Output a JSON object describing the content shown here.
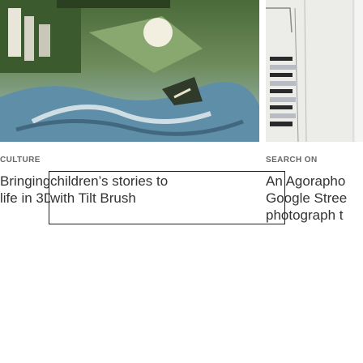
{
  "cards": [
    {
      "category": "CULTURE",
      "headline_lines": [
        "Bringing ",
        "life in 3D"
      ]
    },
    {
      "category": "SEARCH ON",
      "headline_lines": [
        "An Agorapho",
        "Google Stree",
        "photograph t"
      ]
    }
  ],
  "highlight": {
    "lines": [
      "children’s stories to",
      "with Tilt Brush"
    ]
  },
  "colors": {
    "category_text": "#666666",
    "headline_text": "#333333",
    "highlight_border": "#222222",
    "background": "#ffffff"
  },
  "icons": {
    "card1_image": "painting-scene-illustration",
    "card2_image": "staircase-photo"
  }
}
